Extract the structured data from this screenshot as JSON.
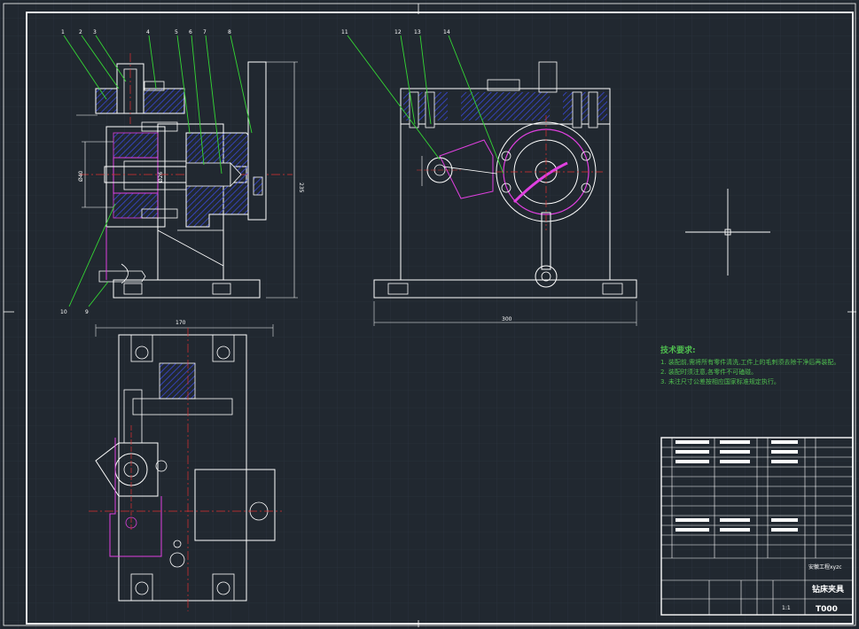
{
  "colors": {
    "background": "#212830",
    "grid": "#2e3742",
    "outline": "#ffffff",
    "leader": "#34d834",
    "hatch": "#3848d8",
    "magenta": "#e040e0",
    "centerline": "#e03030",
    "text_green": "#4fbf4f"
  },
  "part_numbers": [
    "1",
    "2",
    "3",
    "4",
    "5",
    "6",
    "7",
    "8",
    "9",
    "10",
    "11",
    "12",
    "13",
    "14"
  ],
  "dimensions": {
    "front_height": "235",
    "front_bore": "Ø40",
    "front_inner": "Ø26",
    "right_width": "300",
    "top_width": "170"
  },
  "tech_requirements": {
    "title": "技术要求:",
    "lines": [
      "1. 装配前,需将所有零件清洗,工件上的毛刺须去除干净后再装配。",
      "2. 装配时须注意,各零件不可磕碰。",
      "3. 未注尺寸公差按相应国家标准规定执行。"
    ]
  },
  "title_block": {
    "school": "安徽工程xyzc",
    "drawing_name": "钻床夹具",
    "drawing_code": "T000",
    "scale": "1:1"
  }
}
